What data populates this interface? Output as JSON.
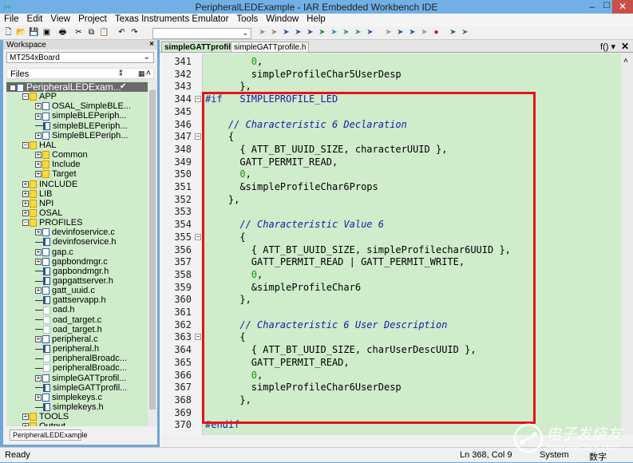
{
  "window": {
    "title": "PeripheralLEDExample - IAR Embedded Workbench IDE",
    "minimize": "–",
    "maximize": "☐",
    "close": "✕"
  },
  "menu": [
    "File",
    "Edit",
    "View",
    "Project",
    "Texas Instruments Emulator",
    "Tools",
    "Window",
    "Help"
  ],
  "toolbar": {
    "icons": [
      "new-file",
      "open",
      "save",
      "save-all",
      "print",
      "cut",
      "copy",
      "paste",
      "undo",
      "redo"
    ],
    "combo_value": "",
    "combo_chevron": "⌄"
  },
  "workspace": {
    "title": "Workspace",
    "close": "×",
    "config": "MT254xBoard",
    "files_label": "Files",
    "bottom_tab": "PeripheralLEDExample",
    "tree": [
      {
        "depth": 0,
        "label": "PeripheralLEDExam...",
        "type": "project",
        "toggle": "⊟",
        "selected": true,
        "check": "✔"
      },
      {
        "depth": 1,
        "label": "APP",
        "type": "folder",
        "toggle": "⊟"
      },
      {
        "depth": 2,
        "label": "OSAL_SimpleBLE...",
        "type": "c",
        "toggle": "⊞"
      },
      {
        "depth": 2,
        "label": "simpleBLEPeriph...",
        "type": "c",
        "toggle": "⊞"
      },
      {
        "depth": 2,
        "label": "simpleBLEPeriph...",
        "type": "h",
        "toggle": ""
      },
      {
        "depth": 2,
        "label": "SimpleBLEPeriph...",
        "type": "c",
        "toggle": "⊞"
      },
      {
        "depth": 1,
        "label": "HAL",
        "type": "folder",
        "toggle": "⊟"
      },
      {
        "depth": 2,
        "label": "Common",
        "type": "folder",
        "toggle": "⊞"
      },
      {
        "depth": 2,
        "label": "Include",
        "type": "folder",
        "toggle": "⊞"
      },
      {
        "depth": 2,
        "label": "Target",
        "type": "folder",
        "toggle": "⊞"
      },
      {
        "depth": 1,
        "label": "INCLUDE",
        "type": "folder",
        "toggle": "⊞"
      },
      {
        "depth": 1,
        "label": "LIB",
        "type": "folder",
        "toggle": "⊞"
      },
      {
        "depth": 1,
        "label": "NPI",
        "type": "folder",
        "toggle": "⊞"
      },
      {
        "depth": 1,
        "label": "OSAL",
        "type": "folder",
        "toggle": "⊞"
      },
      {
        "depth": 1,
        "label": "PROFILES",
        "type": "folder",
        "toggle": "⊟"
      },
      {
        "depth": 2,
        "label": "devinfoservice.c",
        "type": "c",
        "toggle": "⊞"
      },
      {
        "depth": 2,
        "label": "devinfoservice.h",
        "type": "h",
        "toggle": ""
      },
      {
        "depth": 2,
        "label": "gap.c",
        "type": "c",
        "toggle": "⊞"
      },
      {
        "depth": 2,
        "label": "gapbondmgr.c",
        "type": "c",
        "toggle": "⊞"
      },
      {
        "depth": 2,
        "label": "gapbondmgr.h",
        "type": "h",
        "toggle": ""
      },
      {
        "depth": 2,
        "label": "gapgattserver.h",
        "type": "h",
        "toggle": ""
      },
      {
        "depth": 2,
        "label": "gatt_uuid.c",
        "type": "c",
        "toggle": "⊞"
      },
      {
        "depth": 2,
        "label": "gattservapp.h",
        "type": "h",
        "toggle": ""
      },
      {
        "depth": 2,
        "label": "oad.h",
        "type": "excluded",
        "toggle": ""
      },
      {
        "depth": 2,
        "label": "oad_target.c",
        "type": "excluded",
        "toggle": ""
      },
      {
        "depth": 2,
        "label": "oad_target.h",
        "type": "excluded",
        "toggle": ""
      },
      {
        "depth": 2,
        "label": "peripheral.c",
        "type": "c",
        "toggle": "⊞"
      },
      {
        "depth": 2,
        "label": "peripheral.h",
        "type": "h",
        "toggle": ""
      },
      {
        "depth": 2,
        "label": "peripheralBroadc...",
        "type": "excluded",
        "toggle": ""
      },
      {
        "depth": 2,
        "label": "peripheralBroadc...",
        "type": "excluded",
        "toggle": ""
      },
      {
        "depth": 2,
        "label": "simpleGATTprofil...",
        "type": "c",
        "toggle": "⊞"
      },
      {
        "depth": 2,
        "label": "simpleGATTprofil...",
        "type": "h",
        "toggle": ""
      },
      {
        "depth": 2,
        "label": "simplekeys.c",
        "type": "c",
        "toggle": "⊞"
      },
      {
        "depth": 2,
        "label": "simplekeys.h",
        "type": "h",
        "toggle": ""
      },
      {
        "depth": 1,
        "label": "TOOLS",
        "type": "folder",
        "toggle": "⊞"
      },
      {
        "depth": 1,
        "label": "Output",
        "type": "folder",
        "toggle": "⊞"
      }
    ]
  },
  "editor": {
    "tabs": [
      {
        "label": "simpleGATTprofile.c",
        "active": true
      },
      {
        "label": "simpleGATTprofile.h",
        "active": false
      }
    ],
    "function_nav": "f()",
    "nav_chevron": "▾",
    "close": "✕",
    "lines": [
      {
        "n": "341",
        "segs": [
          [
            "        ",
            ""
          ],
          [
            "0",
            "num"
          ],
          [
            ",",
            ""
          ]
        ]
      },
      {
        "n": "342",
        "segs": [
          [
            "        simpleProfileChar5UserDesp",
            ""
          ]
        ]
      },
      {
        "n": "343",
        "segs": [
          [
            "      },",
            ""
          ]
        ]
      },
      {
        "n": "344",
        "fold": "⊟",
        "segs": [
          [
            "#if   SIMPLEPROFILE_LED",
            "kw"
          ]
        ]
      },
      {
        "n": "345",
        "segs": []
      },
      {
        "n": "346",
        "segs": [
          [
            "    ",
            ""
          ],
          [
            "// Characteristic 6 Declaration",
            "cm"
          ]
        ]
      },
      {
        "n": "347",
        "fold": "⊟",
        "segs": [
          [
            "    {",
            ""
          ]
        ]
      },
      {
        "n": "348",
        "segs": [
          [
            "      { ATT_BT_UUID_SIZE, characterUUID },",
            ""
          ]
        ]
      },
      {
        "n": "349",
        "segs": [
          [
            "      GATT_PERMIT_READ,",
            ""
          ]
        ]
      },
      {
        "n": "350",
        "segs": [
          [
            "      ",
            ""
          ],
          [
            "0",
            "num"
          ],
          [
            ",",
            ""
          ]
        ]
      },
      {
        "n": "351",
        "segs": [
          [
            "      &simpleProfileChar6Props",
            ""
          ]
        ]
      },
      {
        "n": "352",
        "segs": [
          [
            "    },",
            ""
          ]
        ]
      },
      {
        "n": "353",
        "segs": []
      },
      {
        "n": "354",
        "segs": [
          [
            "      ",
            ""
          ],
          [
            "// Characteristic Value 6",
            "cm"
          ]
        ]
      },
      {
        "n": "355",
        "fold": "⊟",
        "segs": [
          [
            "      {",
            ""
          ]
        ]
      },
      {
        "n": "356",
        "segs": [
          [
            "        { ATT_BT_UUID_SIZE, simpleProfilechar6UUID },",
            ""
          ]
        ]
      },
      {
        "n": "357",
        "segs": [
          [
            "        GATT_PERMIT_READ | GATT_PERMIT_WRITE,",
            ""
          ]
        ]
      },
      {
        "n": "358",
        "segs": [
          [
            "        ",
            ""
          ],
          [
            "0",
            "num"
          ],
          [
            ",",
            ""
          ]
        ]
      },
      {
        "n": "359",
        "segs": [
          [
            "        &simpleProfileChar6",
            ""
          ]
        ]
      },
      {
        "n": "360",
        "segs": [
          [
            "      },",
            ""
          ]
        ]
      },
      {
        "n": "361",
        "segs": []
      },
      {
        "n": "362",
        "segs": [
          [
            "      ",
            ""
          ],
          [
            "// Characteristic 6 User Description",
            "cm"
          ]
        ]
      },
      {
        "n": "363",
        "fold": "⊟",
        "segs": [
          [
            "      {",
            ""
          ]
        ]
      },
      {
        "n": "364",
        "segs": [
          [
            "        { ATT_BT_UUID_SIZE, charUserDescUUID },",
            ""
          ]
        ]
      },
      {
        "n": "365",
        "segs": [
          [
            "        GATT_PERMIT_READ,",
            ""
          ]
        ]
      },
      {
        "n": "366",
        "segs": [
          [
            "        ",
            ""
          ],
          [
            "0",
            "num"
          ],
          [
            ",",
            ""
          ]
        ]
      },
      {
        "n": "367",
        "segs": [
          [
            "        simpleProfileChar6UserDesp",
            ""
          ]
        ]
      },
      {
        "n": "368",
        "segs": [
          [
            "      },",
            ""
          ]
        ]
      },
      {
        "n": "369",
        "segs": []
      },
      {
        "n": "370",
        "segs": [
          [
            "#endif",
            "kw"
          ]
        ]
      }
    ],
    "highlight_color": "#e8121a"
  },
  "status": {
    "left": "Ready",
    "position": "Ln 368, Col 9",
    "encoding": "System",
    "mode": "数字"
  },
  "watermark": {
    "cn": "电子发烧友",
    "url": "www.elecfans.com"
  }
}
